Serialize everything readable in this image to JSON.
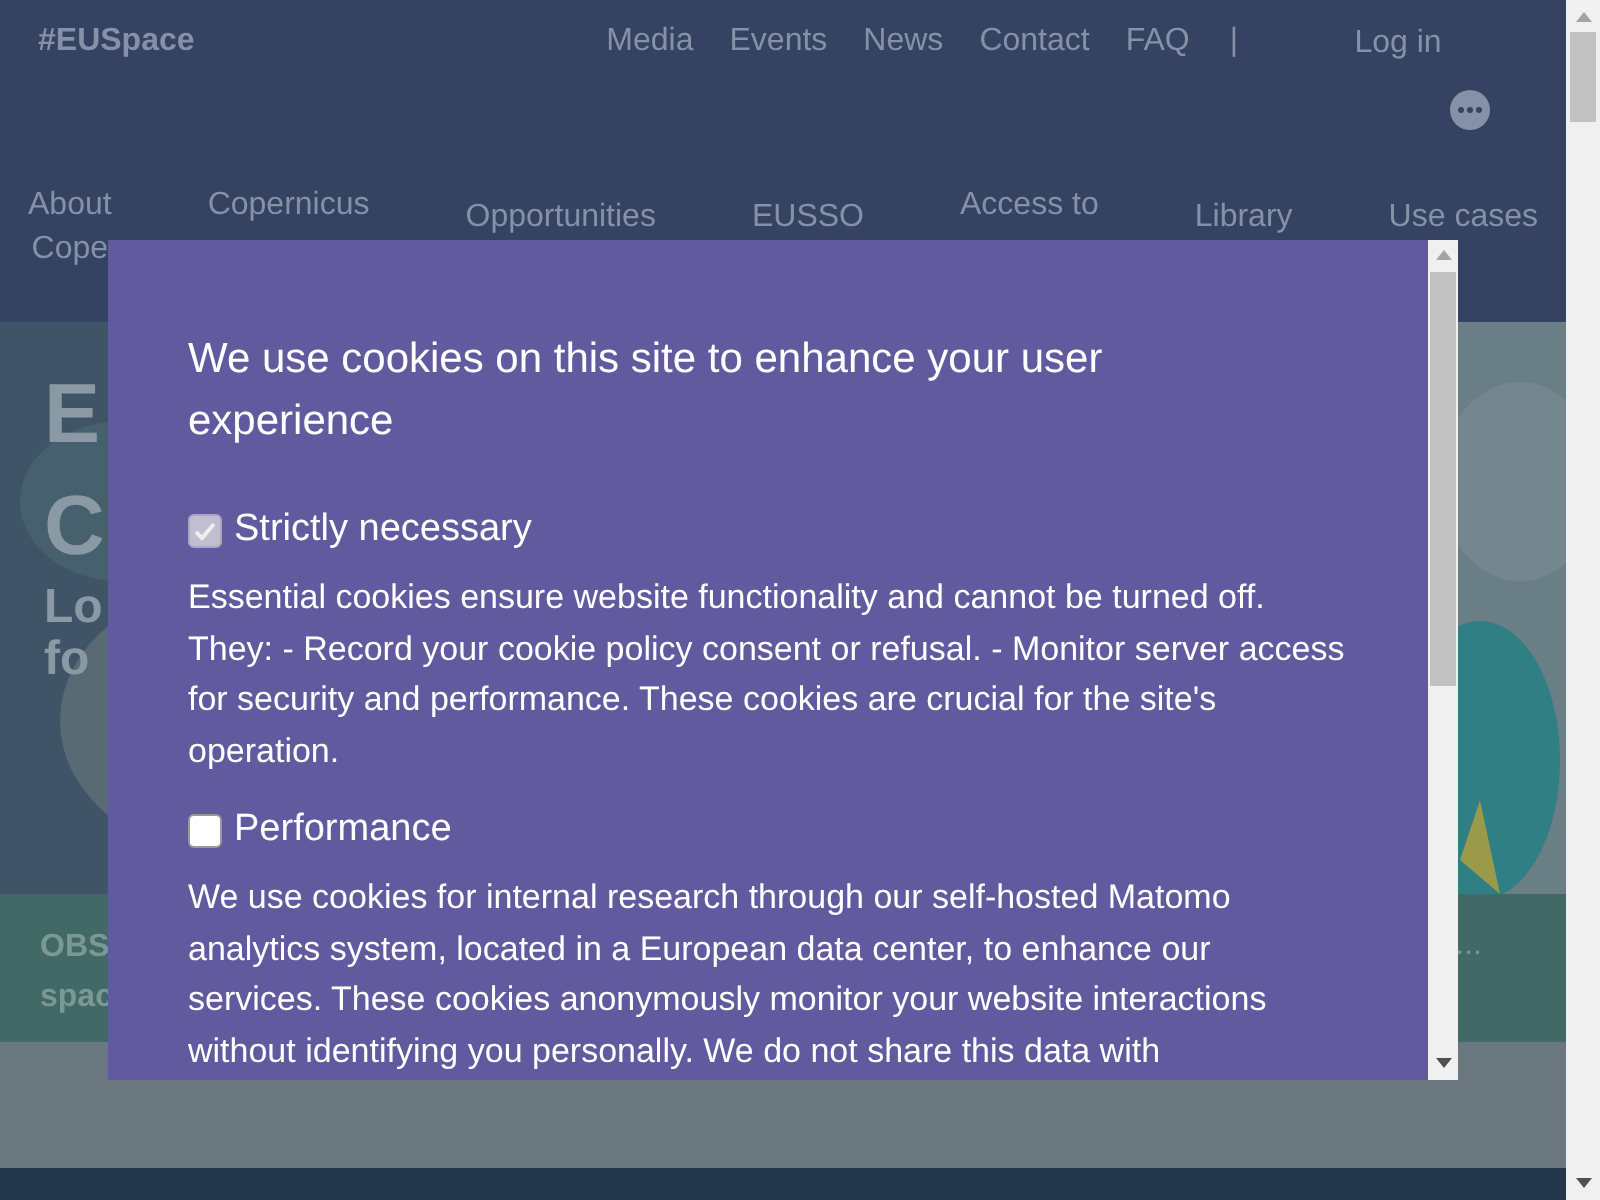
{
  "header": {
    "logo": "#EUSpace",
    "top_links": [
      "Media",
      "Events",
      "News",
      "Contact",
      "FAQ"
    ],
    "separator": "|",
    "login": "Log in",
    "main_nav": [
      {
        "lines": [
          "About",
          "Cope"
        ]
      },
      {
        "lines": [
          "Copernicus"
        ]
      },
      {
        "lines": [
          "Opportunities"
        ]
      },
      {
        "lines": [
          "EUSSO"
        ]
      },
      {
        "lines": [
          "Access to"
        ]
      },
      {
        "lines": [
          "Library"
        ]
      },
      {
        "lines": [
          "Use cases"
        ]
      }
    ]
  },
  "hero": {
    "title_lines": [
      "E",
      "C"
    ],
    "subtitle_lines": [
      "Lo",
      "fo"
    ]
  },
  "band": {
    "lines": [
      "OBS",
      "spac"
    ],
    "trailing": "..."
  },
  "cookie_dialog": {
    "title": "We use cookies on this site to enhance your user experience",
    "categories": [
      {
        "label": "Strictly necessary",
        "checked": true,
        "disabled": true,
        "description": "Essential cookies ensure website functionality and cannot be turned off. They: - Record your cookie policy consent or refusal. - Monitor server access for security and performance. These cookies are crucial for the site's operation."
      },
      {
        "label": "Performance",
        "checked": false,
        "disabled": false,
        "description": "We use cookies for internal research through our self-hosted Matomo analytics system, located in a European data center, to enhance our services. These cookies anonymously monitor your website interactions without identifying you personally. We do not share this data with"
      }
    ]
  }
}
